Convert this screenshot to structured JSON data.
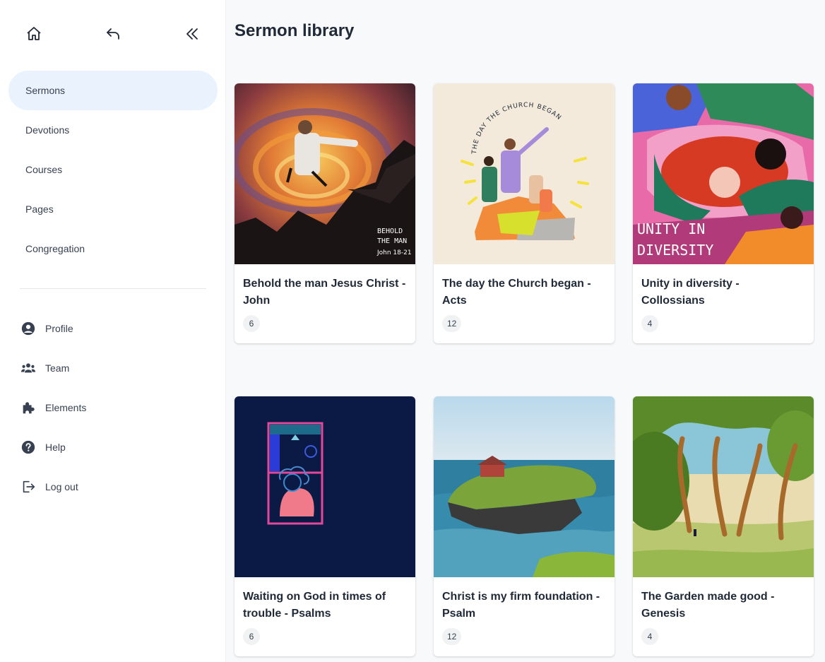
{
  "sidebar": {
    "nav": [
      {
        "label": "Sermons",
        "active": true
      },
      {
        "label": "Devotions"
      },
      {
        "label": "Courses"
      },
      {
        "label": "Pages"
      },
      {
        "label": "Congregation"
      }
    ],
    "bottom": [
      {
        "label": "Profile",
        "icon": "user-circle-icon"
      },
      {
        "label": "Team",
        "icon": "team-icon"
      },
      {
        "label": "Elements",
        "icon": "puzzle-icon"
      },
      {
        "label": "Help",
        "icon": "help-icon"
      },
      {
        "label": "Log out",
        "icon": "logout-icon"
      }
    ],
    "top_icons": [
      "home-icon",
      "back-arrow-icon",
      "collapse-icon"
    ]
  },
  "main": {
    "title": "Sermon library",
    "cards": [
      {
        "title": "Behold the man Jesus Christ - John",
        "count": "6",
        "art_text": [
          "BEHOLD",
          "THE MAN",
          "John 18-21"
        ]
      },
      {
        "title": "The day the Church began - Acts",
        "count": "12",
        "art_text": [
          "THE DAY THE CHURCH BEGAN"
        ]
      },
      {
        "title": "Unity in diversity - Collossians",
        "count": "4",
        "art_text": [
          "UNITY IN",
          "DIVERSITY"
        ]
      },
      {
        "title": "Waiting on God in times of trouble - Psalms",
        "count": "6"
      },
      {
        "title": "Christ is my firm foundation - Psalm",
        "count": "12"
      },
      {
        "title": "The Garden made good - Genesis",
        "count": "4"
      }
    ]
  },
  "colors": {
    "accent_bg": "#eaf2fd",
    "page_bg": "#f8f9fb"
  }
}
